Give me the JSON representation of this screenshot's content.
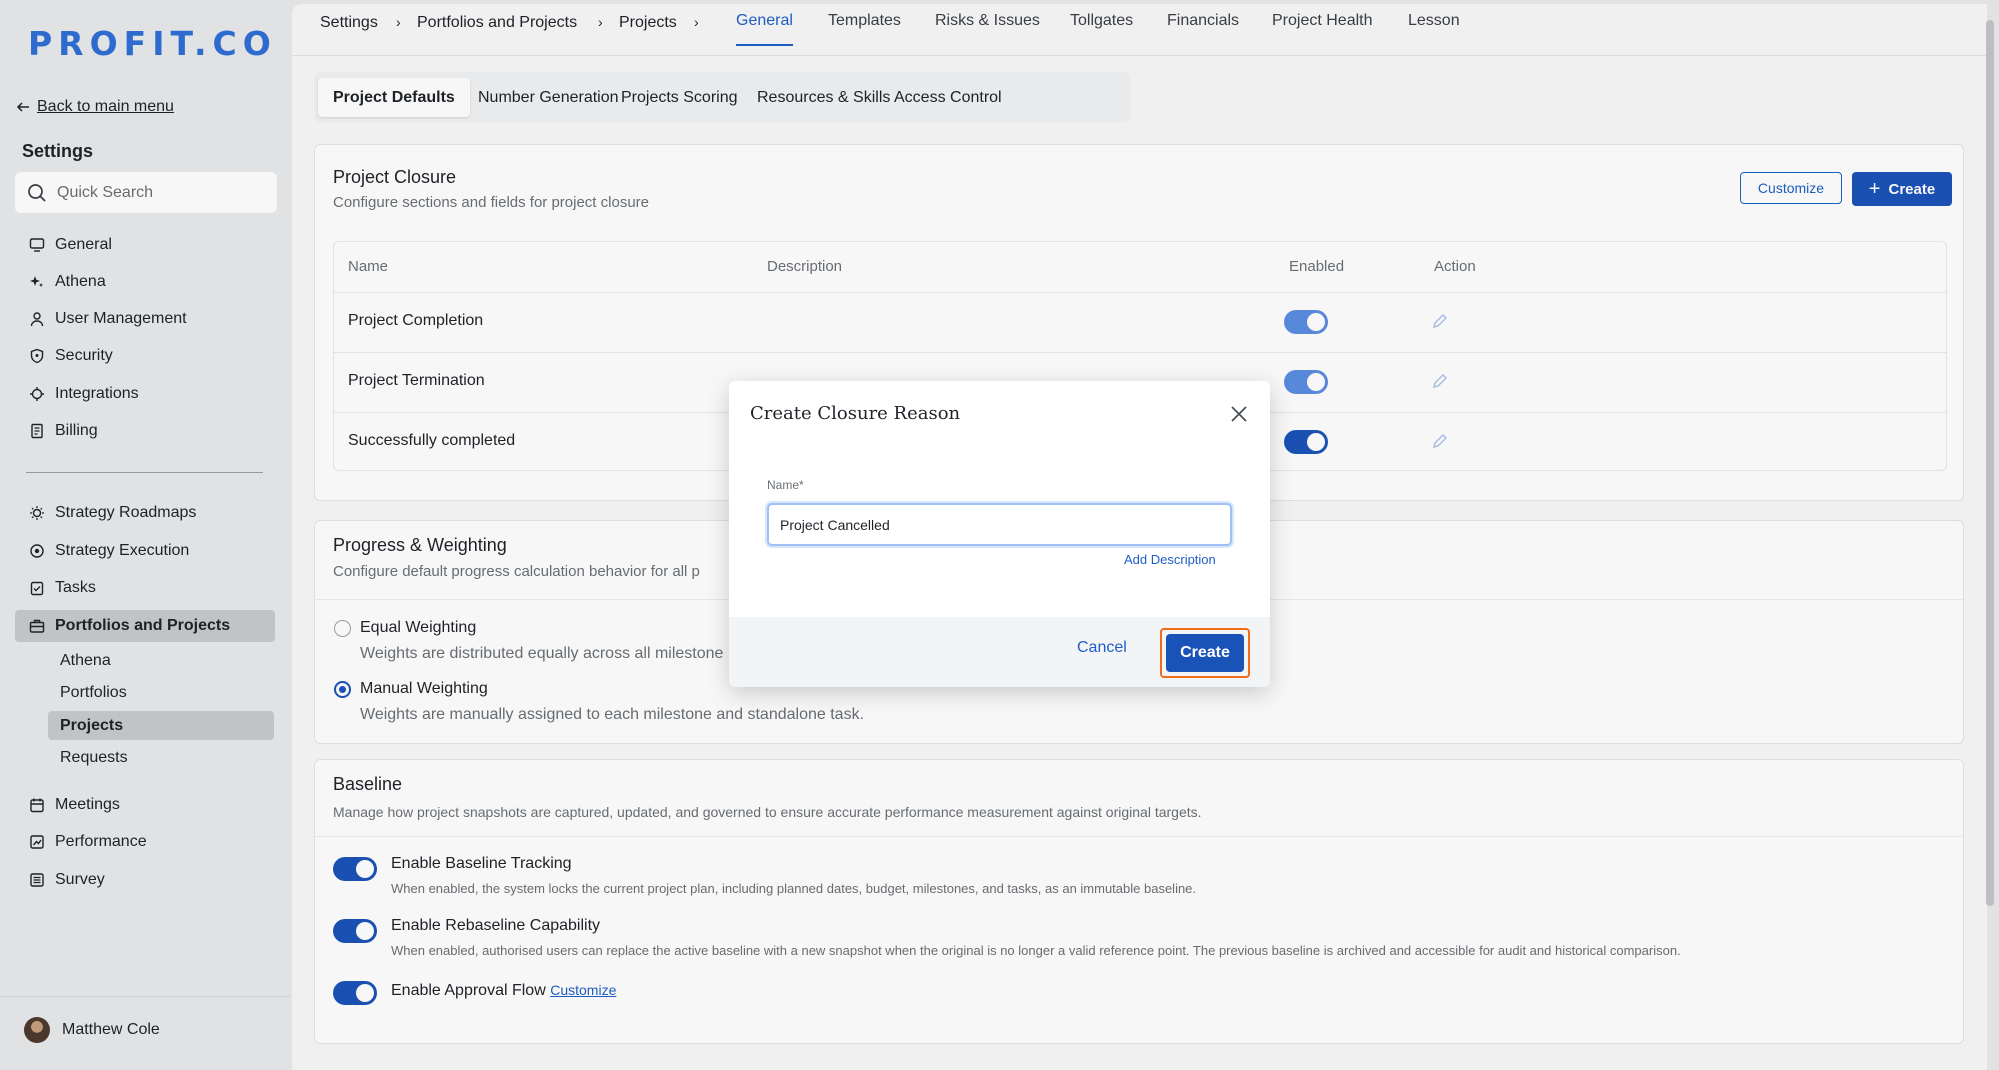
{
  "brand": {
    "logo_text": "PROFIT.CO",
    "accent": "#1a53b8",
    "logo_color": "#2f6fd6"
  },
  "sidebar": {
    "back_label": "Back to main menu",
    "title": "Settings",
    "search_placeholder": "Quick Search",
    "items": [
      {
        "label": "General",
        "icon": "monitor-icon"
      },
      {
        "label": "Athena",
        "icon": "sparkle-icon"
      },
      {
        "label": "User Management",
        "icon": "user-icon"
      },
      {
        "label": "Security",
        "icon": "shield-icon"
      },
      {
        "label": "Integrations",
        "icon": "plug-icon"
      },
      {
        "label": "Billing",
        "icon": "receipt-icon"
      },
      {
        "label": "Strategy Roadmaps",
        "icon": "bulb-icon"
      },
      {
        "label": "Strategy Execution",
        "icon": "target-icon"
      },
      {
        "label": "Tasks",
        "icon": "checklist-icon"
      },
      {
        "label": "Portfolios and Projects",
        "icon": "briefcase-icon"
      },
      {
        "label": "Meetings",
        "icon": "calendar-icon"
      },
      {
        "label": "Performance",
        "icon": "chart-icon"
      },
      {
        "label": "Survey",
        "icon": "list-icon"
      }
    ],
    "sub_items": [
      "Athena",
      "Portfolios",
      "Projects",
      "Requests"
    ],
    "user_name": "Matthew Cole"
  },
  "topbar": {
    "breadcrumbs": [
      "Settings",
      "Portfolios and Projects",
      "Projects"
    ],
    "tabs": [
      "General",
      "Templates",
      "Risks & Issues",
      "Tollgates",
      "Financials",
      "Project Health",
      "Lesson"
    ]
  },
  "subtabs": [
    "Project Defaults",
    "Number Generation",
    "Projects Scoring",
    "Resources & Skills",
    "Access Control"
  ],
  "closure": {
    "title": "Project Closure",
    "subtitle": "Configure sections and fields for project closure",
    "customize_label": "Customize",
    "create_label": "Create",
    "columns": [
      "Name",
      "Description",
      "Enabled",
      "Action"
    ],
    "rows": [
      {
        "name": "Project Completion",
        "enabled": true
      },
      {
        "name": "Project Termination",
        "enabled": true
      },
      {
        "name": "Successfully completed",
        "enabled": true
      }
    ]
  },
  "progress": {
    "title": "Progress & Weighting",
    "subtitle": "Configure default progress calculation behavior for all p",
    "options": [
      {
        "label": "Equal Weighting",
        "desc": "Weights are distributed equally across all milestone",
        "checked": false
      },
      {
        "label": "Manual Weighting",
        "desc": "Weights are manually assigned to each milestone and standalone task.",
        "checked": true
      }
    ]
  },
  "baseline": {
    "title": "Baseline",
    "subtitle": "Manage how project snapshots are captured, updated, and governed to ensure accurate performance measurement against original targets.",
    "items": [
      {
        "title": "Enable Baseline Tracking",
        "desc": "When enabled, the system locks the current project plan, including planned dates, budget, milestones, and tasks, as an immutable baseline.",
        "enabled": true
      },
      {
        "title": "Enable Rebaseline Capability",
        "desc": "When enabled, authorised users can replace the active baseline with a new snapshot when the original is no longer a valid reference point. The previous baseline is archived and accessible for audit and historical comparison.",
        "enabled": true
      },
      {
        "title": "Enable Approval Flow",
        "link": "Customize",
        "enabled": true
      }
    ]
  },
  "modal": {
    "title": "Create Closure Reason",
    "field_label": "Name*",
    "field_value": "Project Cancelled",
    "add_description": "Add Description",
    "cancel_label": "Cancel",
    "create_label": "Create"
  }
}
